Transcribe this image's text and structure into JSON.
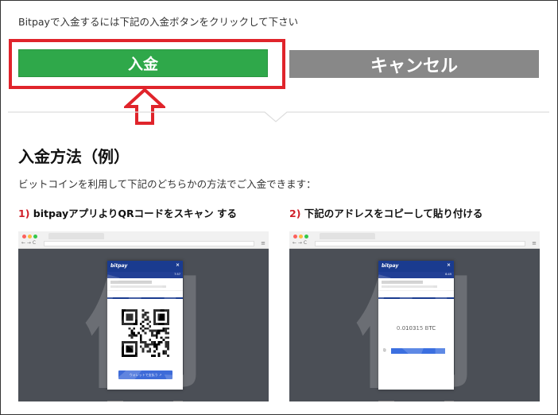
{
  "instruction": "Bitpayで入金するには下記の入金ボタンをクリックして下さい",
  "buttons": {
    "deposit": "入金",
    "cancel": "キャンセル"
  },
  "section": {
    "title": "入金方法（例）",
    "description": "ビットコインを利用して下記のどちらかの方法でご入金できます："
  },
  "methods": [
    {
      "num": "1)",
      "text": " bitpayアプリよりQRコードをスキャン する"
    },
    {
      "num": "2)",
      "text": " 下記のアドレスをコピーして貼り付ける"
    }
  ],
  "mockup": {
    "watermark": "例",
    "modal_title": "bitpay",
    "close": "×",
    "timer": "7:57",
    "timer_2": "6:49",
    "wallet_button": "ウォレットで支払う ↗",
    "amount": "0.010315 BTC"
  },
  "colors": {
    "deposit_green": "#2fa84a",
    "cancel_gray": "#888888",
    "highlight_red": "#e0242b",
    "bitpay_blue": "#1a3b8f"
  },
  "icons": [
    "arrow-up-icon",
    "close-icon",
    "menu-icon",
    "copy-icon"
  ]
}
